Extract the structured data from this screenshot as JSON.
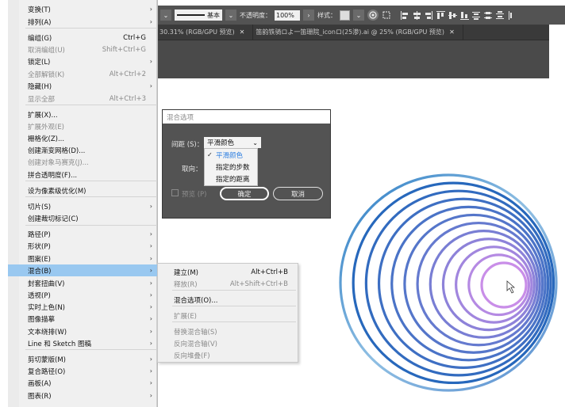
{
  "control_bar": {
    "stroke_profile": "基本",
    "opacity_label": "不透明度：",
    "opacity_value": "100%",
    "style_label": "样式：",
    "dropdown_arrow": "⌄",
    "chevron_right": "›"
  },
  "document_tabs": [
    {
      "label": "30.31% (RGB/GPU 预览)",
      "close": "✕"
    },
    {
      "label": "笛韵铁骑ロよ一笛珊院_iconロ(25渗).ai @ 25% (RGB/GPU 预览)",
      "close": "✕"
    }
  ],
  "object_menu": {
    "items": [
      {
        "label": "变换(T)",
        "shortcut": "",
        "arrow": "›",
        "disabled": false
      },
      {
        "label": "排列(A)",
        "shortcut": "",
        "arrow": "›",
        "disabled": false
      },
      {
        "label": "编组(G)",
        "shortcut": "Ctrl+G",
        "arrow": "",
        "disabled": false
      },
      {
        "label": "取消编组(U)",
        "shortcut": "Shift+Ctrl+G",
        "arrow": "",
        "disabled": true
      },
      {
        "label": "锁定(L)",
        "shortcut": "",
        "arrow": "›",
        "disabled": false
      },
      {
        "label": "全部解锁(K)",
        "shortcut": "Alt+Ctrl+2",
        "arrow": "",
        "disabled": true
      },
      {
        "label": "隐藏(H)",
        "shortcut": "",
        "arrow": "›",
        "disabled": false
      },
      {
        "label": "显示全部",
        "shortcut": "Alt+Ctrl+3",
        "arrow": "",
        "disabled": true
      },
      {
        "label": "扩展(X)...",
        "shortcut": "",
        "arrow": "",
        "disabled": false
      },
      {
        "label": "扩展外观(E)",
        "shortcut": "",
        "arrow": "",
        "disabled": true
      },
      {
        "label": "栅格化(Z)...",
        "shortcut": "",
        "arrow": "",
        "disabled": false
      },
      {
        "label": "创建渐变网格(D)...",
        "shortcut": "",
        "arrow": "",
        "disabled": false
      },
      {
        "label": "创建对象马赛克(J)...",
        "shortcut": "",
        "arrow": "",
        "disabled": true
      },
      {
        "label": "拼合透明度(F)...",
        "shortcut": "",
        "arrow": "",
        "disabled": false
      },
      {
        "label": "设为像素级优化(M)",
        "shortcut": "",
        "arrow": "",
        "disabled": false
      },
      {
        "label": "切片(S)",
        "shortcut": "",
        "arrow": "›",
        "disabled": false
      },
      {
        "label": "创建裁切标记(C)",
        "shortcut": "",
        "arrow": "",
        "disabled": false
      },
      {
        "label": "路径(P)",
        "shortcut": "",
        "arrow": "›",
        "disabled": false
      },
      {
        "label": "形状(P)",
        "shortcut": "",
        "arrow": "›",
        "disabled": false
      },
      {
        "label": "图案(E)",
        "shortcut": "",
        "arrow": "›",
        "disabled": false
      },
      {
        "label": "混合(B)",
        "shortcut": "",
        "arrow": "›",
        "disabled": false,
        "active": true
      },
      {
        "label": "封套扭曲(V)",
        "shortcut": "",
        "arrow": "›",
        "disabled": false
      },
      {
        "label": "透视(P)",
        "shortcut": "",
        "arrow": "›",
        "disabled": false
      },
      {
        "label": "实时上色(N)",
        "shortcut": "",
        "arrow": "›",
        "disabled": false
      },
      {
        "label": "图像描摹",
        "shortcut": "",
        "arrow": "›",
        "disabled": false
      },
      {
        "label": "文本绕排(W)",
        "shortcut": "",
        "arrow": "›",
        "disabled": false
      },
      {
        "label": "Line 和 Sketch 图稿",
        "shortcut": "",
        "arrow": "›",
        "disabled": false
      },
      {
        "label": "剪切蒙版(M)",
        "shortcut": "",
        "arrow": "›",
        "disabled": false
      },
      {
        "label": "复合路径(O)",
        "shortcut": "",
        "arrow": "›",
        "disabled": false
      },
      {
        "label": "画板(A)",
        "shortcut": "",
        "arrow": "›",
        "disabled": false
      },
      {
        "label": "图表(R)",
        "shortcut": "",
        "arrow": "›",
        "disabled": false
      }
    ]
  },
  "blend_submenu": {
    "items": [
      {
        "label": "建立(M)",
        "shortcut": "Alt+Ctrl+B",
        "disabled": false
      },
      {
        "label": "释放(R)",
        "shortcut": "Alt+Shift+Ctrl+B",
        "disabled": true
      },
      {
        "label": "混合选项(O)...",
        "shortcut": "",
        "disabled": false
      },
      {
        "label": "扩展(E)",
        "shortcut": "",
        "disabled": true
      },
      {
        "label": "替换混合轴(S)",
        "shortcut": "",
        "disabled": true
      },
      {
        "label": "反向混合轴(V)",
        "shortcut": "",
        "disabled": true
      },
      {
        "label": "反向堆叠(F)",
        "shortcut": "",
        "disabled": true
      }
    ]
  },
  "blend_dialog": {
    "title": "混合选项",
    "spacing_label": "间距 (S)：",
    "spacing_value": "平滑颜色",
    "orientation_label": "取向：",
    "spacing_options": [
      "平滑颜色",
      "指定的步数",
      "指定的距离"
    ],
    "selected_option": "平滑颜色",
    "check_mark": "✓",
    "preview_label": "预览 (P)",
    "ok_label": "确定",
    "cancel_label": "取消"
  },
  "artwork": {
    "colors": {
      "outer": "#1b64b8",
      "mid": "#5b78cc",
      "inner": "#c98ee8",
      "light": "#a7cde8"
    }
  },
  "colors": {
    "menu_bg": "#f0f0f0",
    "menu_highlight": "#99c8f0",
    "dialog_bg": "#535353",
    "chrome_dark": "#4a4a4a",
    "accent_blue": "#2b7de0"
  }
}
